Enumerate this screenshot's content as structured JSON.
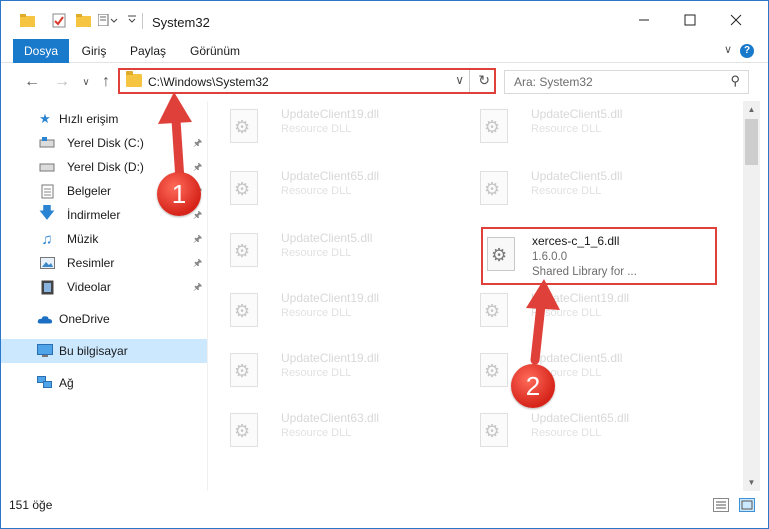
{
  "window": {
    "title": "System32"
  },
  "ribbon": {
    "tabs": [
      {
        "label": "Dosya",
        "active": true
      },
      {
        "label": "Giriş",
        "active": false
      },
      {
        "label": "Paylaş",
        "active": false
      },
      {
        "label": "Görünüm",
        "active": false
      }
    ],
    "help": "?"
  },
  "address": {
    "path": "C:\\Windows\\System32"
  },
  "search": {
    "placeholder": "Ara: System32"
  },
  "sidebar": {
    "items": [
      {
        "label": "Hızlı erişim",
        "icon": "star-icon"
      },
      {
        "label": "Yerel Disk (C:)",
        "icon": "drive-icon",
        "pinned": true
      },
      {
        "label": "Yerel Disk (D:)",
        "icon": "drive-icon",
        "pinned": true
      },
      {
        "label": "Belgeler",
        "icon": "documents-icon",
        "pinned": true
      },
      {
        "label": "İndirmeler",
        "icon": "download-icon",
        "pinned": true
      },
      {
        "label": "Müzik",
        "icon": "music-icon",
        "pinned": true
      },
      {
        "label": "Resimler",
        "icon": "pictures-icon",
        "pinned": true
      },
      {
        "label": "Videolar",
        "icon": "videos-icon",
        "pinned": true
      },
      {
        "label": "OneDrive",
        "icon": "cloud-icon"
      },
      {
        "label": "Bu bilgisayar",
        "icon": "computer-icon",
        "selected": true
      },
      {
        "label": "Ağ",
        "icon": "network-icon"
      }
    ]
  },
  "files": {
    "left": [
      {
        "name": "UpdateClient19.dll",
        "desc": "Resource DLL"
      },
      {
        "name": "UpdateClient65.dll",
        "desc": "Resource DLL"
      },
      {
        "name": "UpdateClient5.dll",
        "desc": "Resource DLL"
      },
      {
        "name": "UpdateClient19.dll",
        "desc": "Resource DLL"
      },
      {
        "name": "UpdateClient19.dll",
        "desc": "Resource DLL"
      },
      {
        "name": "UpdateClient63.dll",
        "desc": "Resource DLL"
      }
    ],
    "right": [
      {
        "name": "UpdateClient5.dll",
        "desc": "Resource DLL"
      },
      {
        "name": "UpdateClient5.dll",
        "desc": "Resource DLL"
      },
      {
        "name": "UpdateClient19.dll",
        "desc": "Resource DLL"
      },
      {
        "name": "UpdateClient5.dll",
        "desc": "Resource DLL"
      },
      {
        "name": "UpdateClient65.dll",
        "desc": "Resource DLL"
      }
    ],
    "highlighted": {
      "name": "xerces-c_1_6.dll",
      "version": "1.6.0.0",
      "desc": "Shared Library for ..."
    }
  },
  "status": {
    "count": "151 öğe"
  },
  "annotations": {
    "step1": "1",
    "step2": "2"
  },
  "colors": {
    "accent": "#1979ca",
    "highlight": "#e0403a"
  }
}
